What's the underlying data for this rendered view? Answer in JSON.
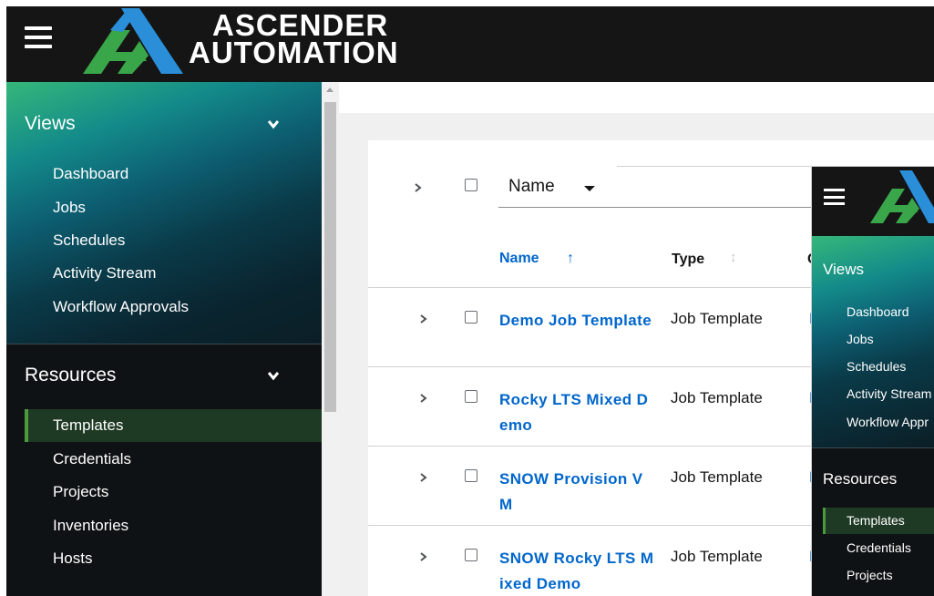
{
  "brand": {
    "line1": "ASCENDER",
    "line2": "AUTOMATION",
    "colors": {
      "green": "#3aa64a",
      "blue": "#2a8fd8",
      "masthead": "#151515"
    }
  },
  "sidebar": {
    "views": {
      "label": "Views",
      "items": [
        "Dashboard",
        "Jobs",
        "Schedules",
        "Activity Stream",
        "Workflow Approvals"
      ]
    },
    "resources": {
      "label": "Resources",
      "items": [
        "Templates",
        "Credentials",
        "Projects",
        "Inventories",
        "Hosts"
      ],
      "active": "Templates"
    }
  },
  "toolbar": {
    "filter_select": "Name",
    "search_value": ""
  },
  "table": {
    "columns": [
      {
        "label": "Name",
        "sort": "ascending"
      },
      {
        "label": "Type",
        "sort": "none"
      },
      {
        "label": "C"
      }
    ],
    "rows": [
      {
        "name": "Demo Job Template",
        "type": "Job Template",
        "third": "D"
      },
      {
        "name": "Rocky LTS Mixed Demo",
        "type": "Job Template",
        "third": "D"
      },
      {
        "name": "SNOW Provision VM",
        "type": "Job Template",
        "third": "D"
      },
      {
        "name": "SNOW Rocky LTS Mixed Demo",
        "type": "Job Template",
        "third": "D"
      }
    ]
  },
  "inset": {
    "views": {
      "label": "Views",
      "items": [
        "Dashboard",
        "Jobs",
        "Schedules",
        "Activity Stream",
        "Workflow Appr"
      ]
    },
    "resources": {
      "label": "Resources",
      "items": [
        "Templates",
        "Credentials",
        "Projects"
      ],
      "active": "Templates"
    }
  },
  "icons": [
    "hamburger-icon",
    "chevron-down-icon",
    "chevron-right-icon",
    "caret-down-icon",
    "sort-up-icon",
    "sort-icon"
  ]
}
